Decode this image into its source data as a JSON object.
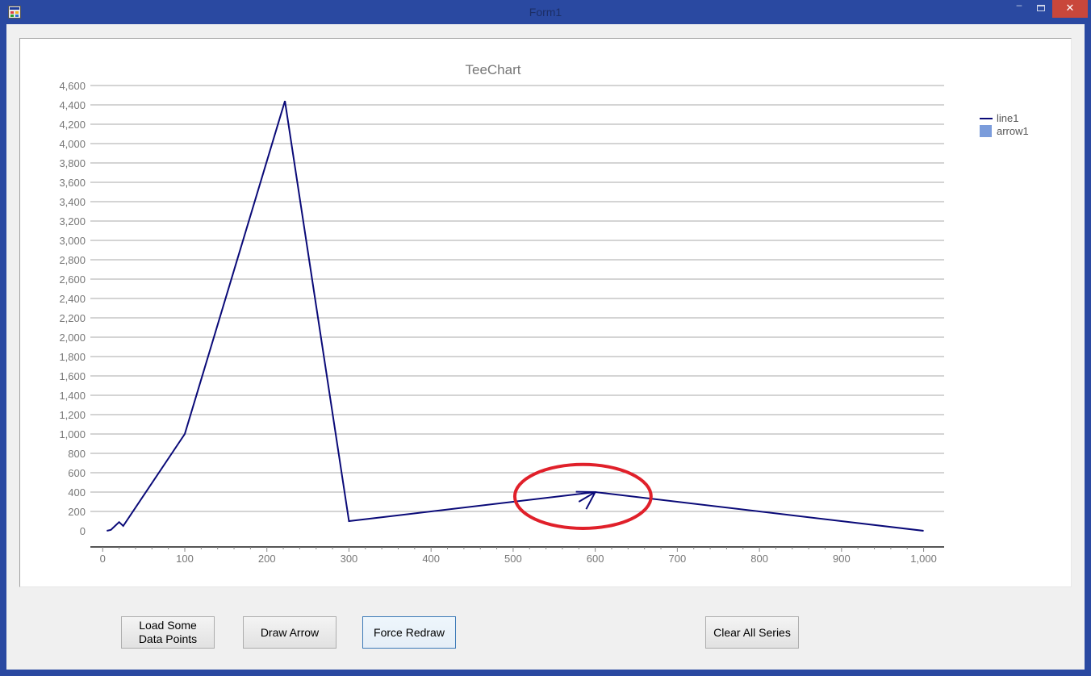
{
  "window": {
    "title": "Form1",
    "close_glyph": "✕",
    "minimize_glyph": "–"
  },
  "buttons": {
    "load_line1": "Load Some",
    "load_line2": "Data Points",
    "draw_arrow": "Draw Arrow",
    "force_redraw": "Force Redraw",
    "clear_all": "Clear All Series"
  },
  "colors": {
    "line": "#0a0a78",
    "arrow_legend": "#7b9cdb",
    "highlight": "#e0202a",
    "gridline": "#a8a8a8"
  },
  "chart_data": {
    "type": "line",
    "title": "TeeChart",
    "xlabel": "",
    "ylabel": "",
    "xlim": [
      -15,
      1025
    ],
    "ylim": [
      0,
      4600
    ],
    "x_ticks": [
      0,
      100,
      200,
      300,
      400,
      500,
      600,
      700,
      800,
      900,
      1000
    ],
    "x_tick_labels": [
      "0",
      "100",
      "200",
      "300",
      "400",
      "500",
      "600",
      "700",
      "800",
      "900",
      "1,000"
    ],
    "y_ticks": [
      0,
      200,
      400,
      600,
      800,
      1000,
      1200,
      1400,
      1600,
      1800,
      2000,
      2200,
      2400,
      2600,
      2800,
      3000,
      3200,
      3400,
      3600,
      3800,
      4000,
      4200,
      4400,
      4600
    ],
    "y_tick_labels": [
      "0",
      "200",
      "400",
      "600",
      "800",
      "1,000",
      "1,200",
      "1,400",
      "1,600",
      "1,800",
      "2,000",
      "2,200",
      "2,400",
      "2,600",
      "2,800",
      "3,000",
      "3,200",
      "3,400",
      "3,600",
      "3,800",
      "4,000",
      "4,200",
      "4,400",
      "4,600"
    ],
    "grid": true,
    "legend_position": "right",
    "series": [
      {
        "name": "line1",
        "type": "line",
        "x": [
          5,
          10,
          15,
          20,
          25,
          100,
          222,
          300,
          600,
          1000
        ],
        "y": [
          0,
          10,
          50,
          90,
          50,
          1000,
          4440,
          100,
          400,
          0
        ]
      },
      {
        "name": "arrow1",
        "type": "arrow",
        "start": {
          "x": 580,
          "y": 300
        },
        "end": {
          "x": 600,
          "y": 400
        }
      }
    ],
    "annotation": {
      "type": "ellipse",
      "center": {
        "x": 585,
        "y": 355
      },
      "rx": 83,
      "ry": 330
    }
  }
}
